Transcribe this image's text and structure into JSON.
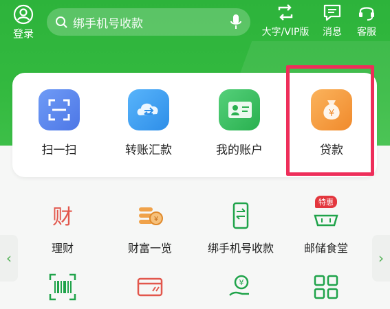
{
  "header": {
    "login_label": "登录",
    "search_placeholder": "绑手机号收款",
    "tools": [
      {
        "label": "大字/VIP版",
        "icon": "swap-icon"
      },
      {
        "label": "消息",
        "icon": "message-icon"
      },
      {
        "label": "客服",
        "icon": "headset-icon"
      }
    ]
  },
  "quick_actions": [
    {
      "label": "扫一扫",
      "icon": "scan-icon"
    },
    {
      "label": "转账汇款",
      "icon": "transfer-icon"
    },
    {
      "label": "我的账户",
      "icon": "account-card-icon"
    },
    {
      "label": "贷款",
      "icon": "money-bag-icon"
    }
  ],
  "services_row1": [
    {
      "label": "理财",
      "icon": "finance-icon"
    },
    {
      "label": "财富一览",
      "icon": "wealth-coins-icon"
    },
    {
      "label": "绑手机号收款",
      "icon": "phone-transfer-icon"
    },
    {
      "label": "邮储食堂",
      "icon": "canteen-icon"
    }
  ],
  "badge_text": "特惠",
  "nav": {
    "prev": "‹",
    "next": "›"
  },
  "colors": {
    "brand_green": "#33b93f",
    "highlight": "#ee2e5a",
    "loan_orange": "#f59a3b",
    "scan_blue": "#5a86ee",
    "transfer_blue": "#3f9cf2",
    "account_green": "#3cc05a",
    "icon_red": "#e74c3c",
    "icon_green": "#1fa34a"
  }
}
